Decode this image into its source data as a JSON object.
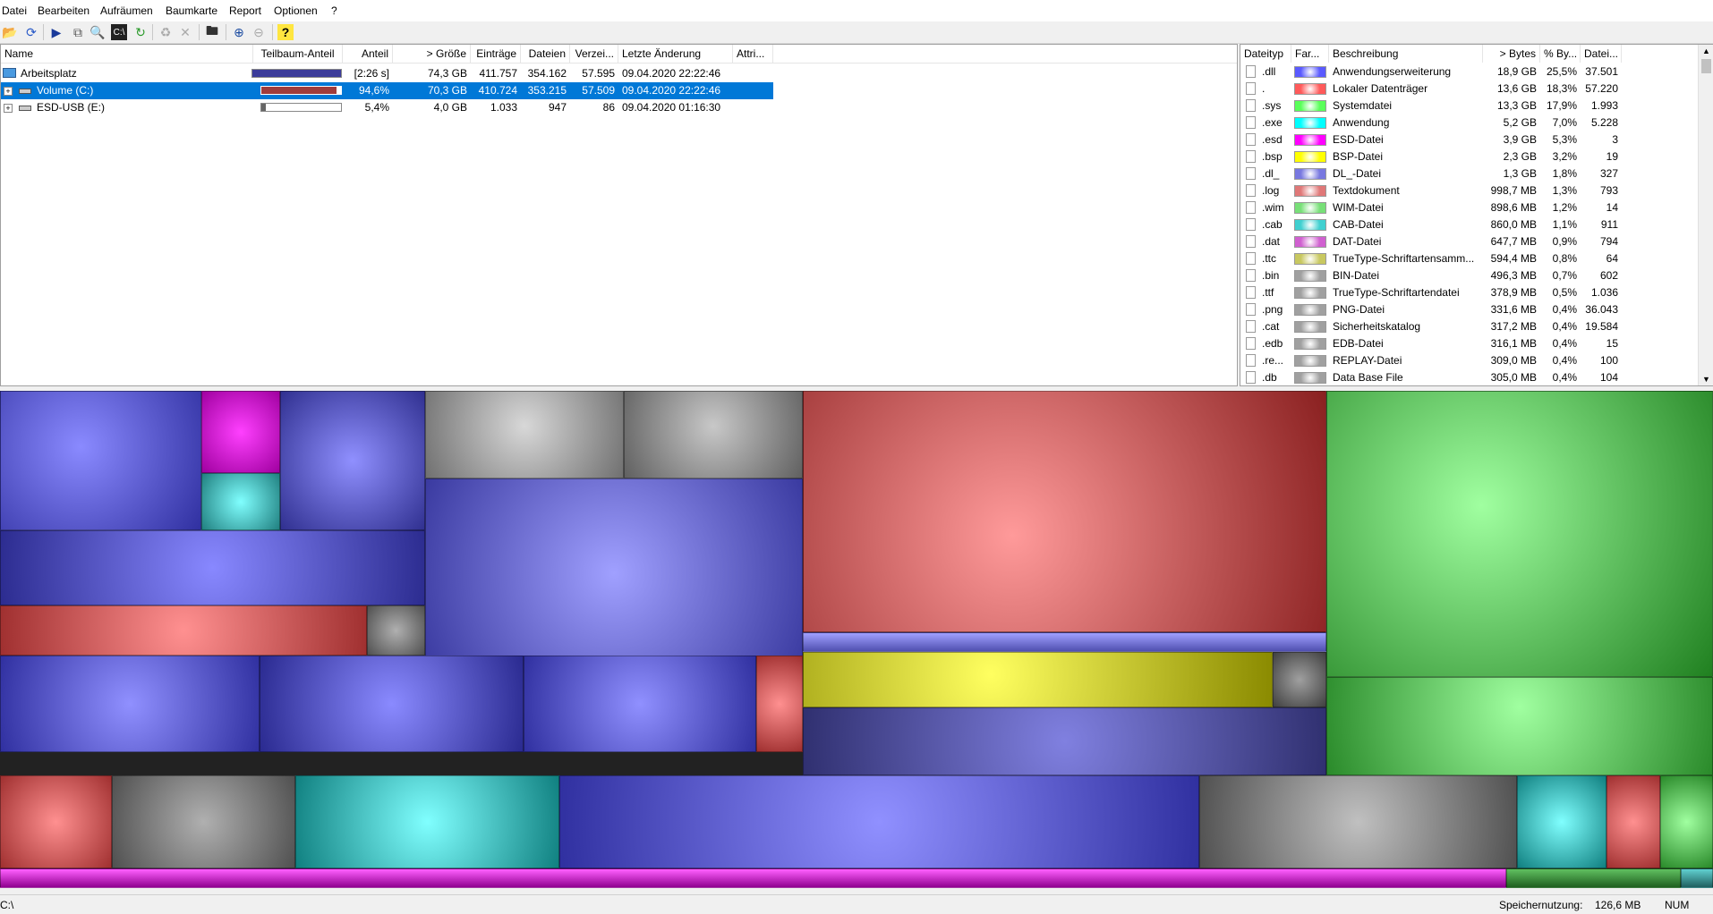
{
  "menu": [
    "Datei",
    "Bearbeiten",
    "Aufräumen",
    "Baumkarte",
    "Report",
    "Optionen",
    "?"
  ],
  "toolbar": {
    "icons": [
      "open-folder-icon",
      "refresh-icon",
      "play-icon",
      "copy-icon",
      "find-icon",
      "console-icon",
      "refresh-all-icon",
      "recycle-icon",
      "delete-icon",
      "folder-icon",
      "zoom-in-icon",
      "zoom-out-icon",
      "help-icon"
    ]
  },
  "tree": {
    "columns": [
      "Name",
      "Teilbaum-Anteil",
      "Anteil",
      "> Größe",
      "Einträge",
      "Dateien",
      "Verzei...",
      "Letzte Änderung",
      "Attri..."
    ],
    "rows": [
      {
        "name": "Arbeitsplatz",
        "subtree": "",
        "share": "[2:26 s]",
        "size": "74,3 GB",
        "entries": "411.757",
        "files": "354.162",
        "dirs": "57.595",
        "modified": "09.04.2020  22:22:46",
        "fill": 1.0,
        "bar_color": "#3c3c9a",
        "icon": "computer-icon"
      },
      {
        "name": "Volume (C:)",
        "subtree": "",
        "share": "94,6%",
        "size": "70,3 GB",
        "entries": "410.724",
        "files": "353.215",
        "dirs": "57.509",
        "modified": "09.04.2020  22:22:46",
        "fill": 0.946,
        "bar_color": "#a03c3c",
        "icon": "drive-icon"
      },
      {
        "name": "ESD-USB (E:)",
        "subtree": "",
        "share": "5,4%",
        "size": "4,0 GB",
        "entries": "1.033",
        "files": "947",
        "dirs": "86",
        "modified": "09.04.2020  01:16:30",
        "fill": 0.054,
        "bar_color": "#666666",
        "icon": "drive-icon"
      }
    ]
  },
  "extensions": {
    "columns": [
      "Dateityp",
      "Far...",
      "Beschreibung",
      "> Bytes",
      "% By...",
      "Datei..."
    ],
    "rows": [
      {
        "ext": ".dll",
        "color": "#5a5aff",
        "desc": "Anwendungserweiterung",
        "bytes": "18,9 GB",
        "pct": "25,5%",
        "files": "37.501"
      },
      {
        "ext": ".",
        "color": "#ff5a5a",
        "desc": "Lokaler Datenträger",
        "bytes": "13,6 GB",
        "pct": "18,3%",
        "files": "57.220"
      },
      {
        "ext": ".sys",
        "color": "#5aff5a",
        "desc": "Systemdatei",
        "bytes": "13,3 GB",
        "pct": "17,9%",
        "files": "1.993"
      },
      {
        "ext": ".exe",
        "color": "#00ffff",
        "desc": "Anwendung",
        "bytes": "5,2 GB",
        "pct": "7,0%",
        "files": "5.228"
      },
      {
        "ext": ".esd",
        "color": "#ff00ff",
        "desc": "ESD-Datei",
        "bytes": "3,9 GB",
        "pct": "5,3%",
        "files": "3"
      },
      {
        "ext": ".bsp",
        "color": "#ffff00",
        "desc": "BSP-Datei",
        "bytes": "2,3 GB",
        "pct": "3,2%",
        "files": "19"
      },
      {
        "ext": ".dl_",
        "color": "#7878e0",
        "desc": "DL_-Datei",
        "bytes": "1,3 GB",
        "pct": "1,8%",
        "files": "327"
      },
      {
        "ext": ".log",
        "color": "#e07878",
        "desc": "Textdokument",
        "bytes": "998,7 MB",
        "pct": "1,3%",
        "files": "793"
      },
      {
        "ext": ".wim",
        "color": "#78e078",
        "desc": "WIM-Datei",
        "bytes": "898,6 MB",
        "pct": "1,2%",
        "files": "14"
      },
      {
        "ext": ".cab",
        "color": "#40d0d0",
        "desc": "CAB-Datei",
        "bytes": "860,0 MB",
        "pct": "1,1%",
        "files": "911"
      },
      {
        "ext": ".dat",
        "color": "#d060d0",
        "desc": "DAT-Datei",
        "bytes": "647,7 MB",
        "pct": "0,9%",
        "files": "794"
      },
      {
        "ext": ".ttc",
        "color": "#c8c860",
        "desc": "TrueType-Schriftartensamm...",
        "bytes": "594,4 MB",
        "pct": "0,8%",
        "files": "64"
      },
      {
        "ext": ".bin",
        "color": "#a0a0a0",
        "desc": "BIN-Datei",
        "bytes": "496,3 MB",
        "pct": "0,7%",
        "files": "602"
      },
      {
        "ext": ".ttf",
        "color": "#a0a0a0",
        "desc": "TrueType-Schriftartendatei",
        "bytes": "378,9 MB",
        "pct": "0,5%",
        "files": "1.036"
      },
      {
        "ext": ".png",
        "color": "#a0a0a0",
        "desc": "PNG-Datei",
        "bytes": "331,6 MB",
        "pct": "0,4%",
        "files": "36.043"
      },
      {
        "ext": ".cat",
        "color": "#a0a0a0",
        "desc": "Sicherheitskatalog",
        "bytes": "317,2 MB",
        "pct": "0,4%",
        "files": "19.584"
      },
      {
        "ext": ".edb",
        "color": "#a0a0a0",
        "desc": "EDB-Datei",
        "bytes": "316,1 MB",
        "pct": "0,4%",
        "files": "15"
      },
      {
        "ext": ".re...",
        "color": "#a0a0a0",
        "desc": "REPLAY-Datei",
        "bytes": "309,0 MB",
        "pct": "0,4%",
        "files": "100"
      },
      {
        "ext": ".db",
        "color": "#a0a0a0",
        "desc": "Data Base File",
        "bytes": "305,0 MB",
        "pct": "0,4%",
        "files": "104"
      }
    ]
  },
  "status": {
    "path": "C:\\",
    "memory_label": "Speichernutzung:",
    "memory_value": "126,6 MB",
    "num": "NUM"
  }
}
